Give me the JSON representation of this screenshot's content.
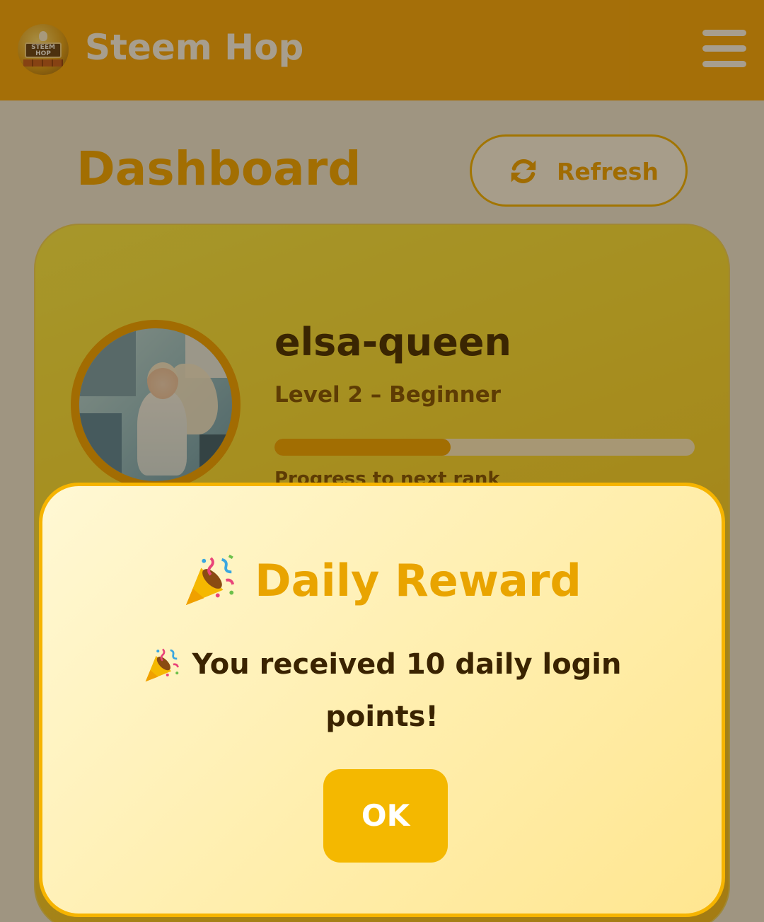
{
  "header": {
    "app_title": "Steem Hop",
    "logo_text": "STEEM HOP",
    "menu_icon": "hamburger-menu-icon"
  },
  "page": {
    "title": "Dashboard",
    "refresh_label": "Refresh",
    "refresh_icon": "refresh-icon"
  },
  "profile": {
    "username": "elsa-queen",
    "rank": "Level 2 – Beginner",
    "progress_fraction": 0.42,
    "progress_caption": "Progress to next rank"
  },
  "modal": {
    "title": "Daily Reward",
    "message": "You received 10 daily login points!",
    "ok_label": "OK",
    "title_icon": "party-popper-icon"
  },
  "colors": {
    "brand": "#fba90c",
    "accent": "#f6a800",
    "modal_button": "#f4b800",
    "text_dark": "#3a2300"
  }
}
